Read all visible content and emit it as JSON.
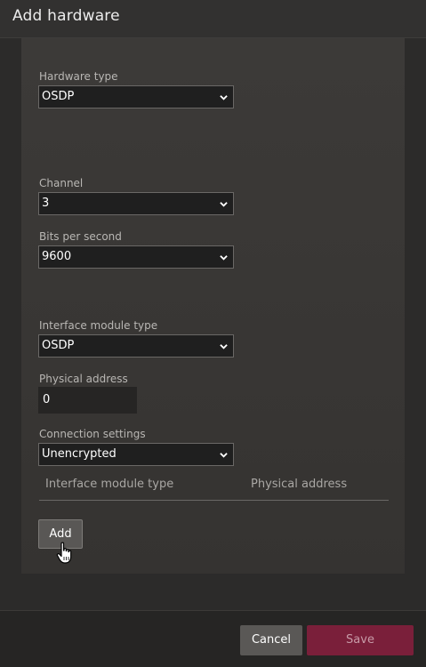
{
  "dialog": {
    "title": "Add hardware"
  },
  "form": {
    "hardware_type": {
      "label": "Hardware type",
      "value": "OSDP"
    },
    "channel": {
      "label": "Channel",
      "value": "3"
    },
    "bits_per_second": {
      "label": "Bits per second",
      "value": "9600"
    },
    "interface_module_type": {
      "label": "Interface module type",
      "value": "OSDP"
    },
    "physical_address": {
      "label": "Physical address",
      "value": "0"
    },
    "connection_settings": {
      "label": "Connection settings",
      "value": "Unencrypted"
    }
  },
  "table": {
    "columns": [
      "Interface module type",
      "Physical address"
    ]
  },
  "buttons": {
    "add": "Add",
    "cancel": "Cancel",
    "save": "Save"
  },
  "colors": {
    "save_button": "#7a1f3a",
    "dialog_background": "#2c2b2a",
    "panel_background": "#3a3836"
  },
  "icons": {
    "dropdown": "chevron-down-icon",
    "cursor": "hand-pointer-icon"
  }
}
